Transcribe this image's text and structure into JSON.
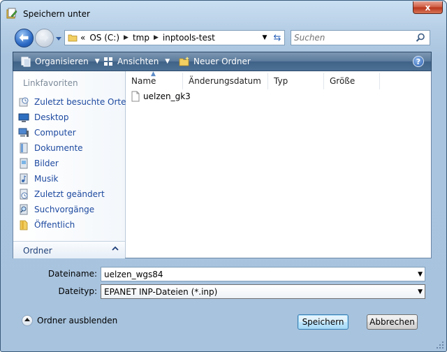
{
  "window": {
    "title": "Speichern unter",
    "close_symbol": "x"
  },
  "address": {
    "overflow": "«",
    "crumbs": [
      "OS (C:)",
      "tmp",
      "inptools-test"
    ],
    "search_placeholder": "Suchen"
  },
  "toolbar": {
    "organize_label": "Organisieren",
    "views_label": "Ansichten",
    "new_folder_label": "Neuer Ordner",
    "help_symbol": "?"
  },
  "nav_pane": {
    "header": "Linkfavoriten",
    "items": [
      {
        "label": "Zuletzt besuchte Orte",
        "icon": "recent-places-icon"
      },
      {
        "label": "Desktop",
        "icon": "desktop-icon"
      },
      {
        "label": "Computer",
        "icon": "computer-icon"
      },
      {
        "label": "Dokumente",
        "icon": "documents-icon"
      },
      {
        "label": "Bilder",
        "icon": "pictures-icon"
      },
      {
        "label": "Musik",
        "icon": "music-icon"
      },
      {
        "label": "Zuletzt geändert",
        "icon": "recently-changed-icon"
      },
      {
        "label": "Suchvorgänge",
        "icon": "searches-icon"
      },
      {
        "label": "Öffentlich",
        "icon": "public-folder-icon"
      }
    ],
    "folders_label": "Ordner"
  },
  "file_list": {
    "columns": [
      "Name",
      "Änderungsdatum",
      "Typ",
      "Größe"
    ],
    "sorted_column": "Name",
    "files": [
      {
        "name": "uelzen_gk3",
        "icon": "file-icon"
      }
    ]
  },
  "form": {
    "filename_label": "Dateiname:",
    "filename_value": "uelzen_wgs84",
    "filetype_label": "Dateityp:",
    "filetype_value": "EPANET INP-Dateien (*.inp)"
  },
  "footer": {
    "hide_folders_label": "Ordner ausblenden",
    "save_label": "Speichern",
    "cancel_label": "Abbrechen"
  },
  "colors": {
    "toolbar": "#4d7095",
    "link_text": "#1e4aa0",
    "close_button": "#c9462c"
  }
}
